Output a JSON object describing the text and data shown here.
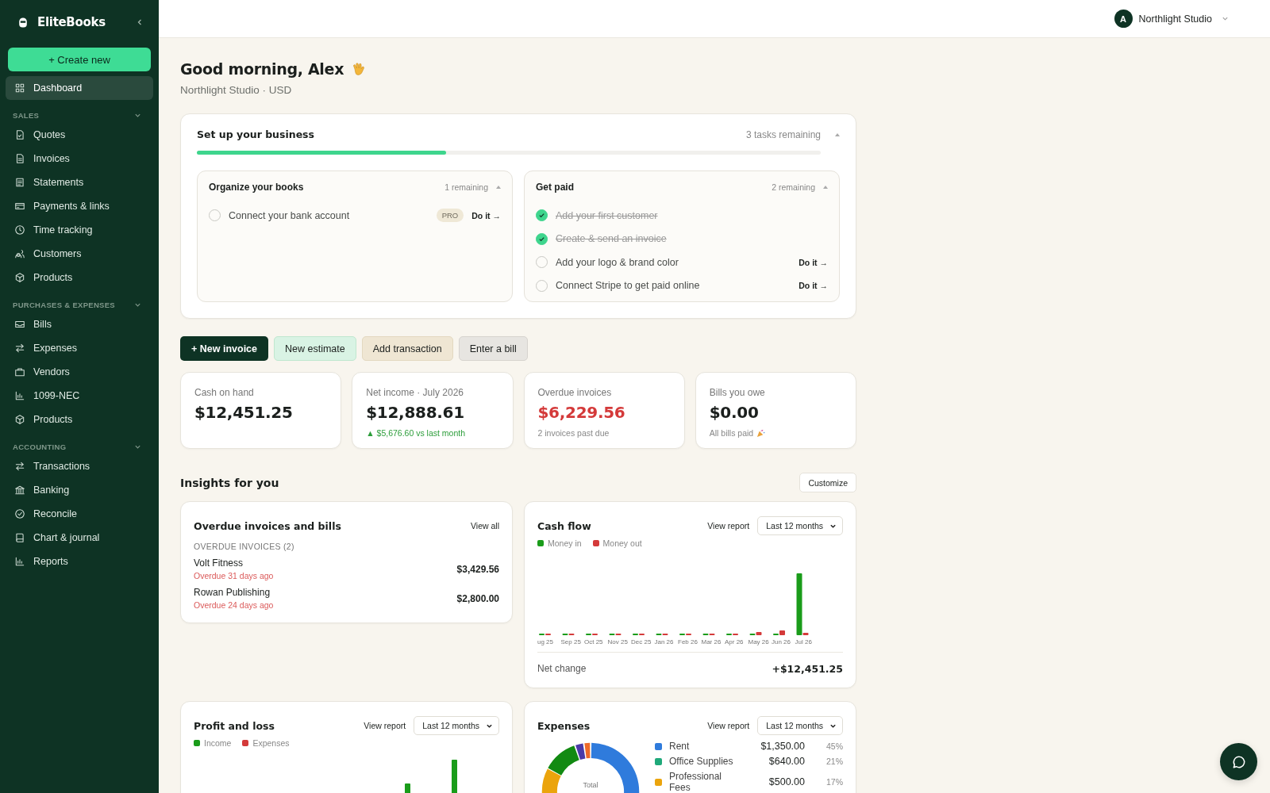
{
  "app": {
    "name": "EliteBooks"
  },
  "sidebar": {
    "create_button": "+ Create new",
    "top_items": [
      {
        "label": "Dashboard",
        "selected": true
      }
    ],
    "sections": [
      {
        "title": "SALES",
        "expanded": true,
        "items": [
          {
            "label": "Quotes",
            "selected": false
          },
          {
            "label": "Invoices",
            "selected": false
          },
          {
            "label": "Statements",
            "selected": false
          },
          {
            "label": "Payments & links",
            "selected": false
          },
          {
            "label": "Time tracking",
            "selected": false
          },
          {
            "label": "Customers",
            "selected": false
          },
          {
            "label": "Products",
            "selected": false
          }
        ]
      },
      {
        "title": "PURCHASES & EXPENSES",
        "expanded": true,
        "items": [
          {
            "label": "Bills",
            "selected": false
          },
          {
            "label": "Expenses",
            "selected": false
          },
          {
            "label": "Vendors",
            "selected": false
          },
          {
            "label": "1099-NEC",
            "selected": false
          },
          {
            "label": "Products",
            "selected": false
          }
        ]
      },
      {
        "title": "ACCOUNTING",
        "expanded": true,
        "items": [
          {
            "label": "Transactions",
            "selected": false
          },
          {
            "label": "Banking",
            "selected": false
          },
          {
            "label": "Reconcile",
            "selected": false
          },
          {
            "label": "Chart & journal",
            "selected": false
          },
          {
            "label": "Reports",
            "selected": false
          }
        ]
      }
    ]
  },
  "topbar": {
    "avatar": "A",
    "account": "Northlight Studio"
  },
  "greeting": {
    "title": "Good morning, Alex",
    "subtitle": "Northlight Studio · USD"
  },
  "setup": {
    "title": "Set up your business",
    "remaining": "3 tasks remaining",
    "level": 0.4,
    "expanded": true,
    "groups": [
      {
        "title": "Organize your books",
        "remaining": "1 remaining",
        "expanded": true,
        "tasks": [
          {
            "label": "Connect your bank account",
            "checked": false,
            "badge": "PRO",
            "action": "Do it →"
          }
        ]
      },
      {
        "title": "Get paid",
        "remaining": "2 remaining",
        "expanded": true,
        "tasks": [
          {
            "label": "Add your first customer",
            "checked": true
          },
          {
            "label": "Create & send an invoice",
            "checked": true
          },
          {
            "label": "Add your logo & brand color",
            "checked": false,
            "action": "Do it →"
          },
          {
            "label": "Connect Stripe to get paid online",
            "checked": false,
            "action": "Do it →"
          }
        ]
      }
    ]
  },
  "quick_actions": [
    {
      "label": "+ New invoice",
      "kind": "primary"
    },
    {
      "label": "New estimate",
      "kind": "mint"
    },
    {
      "label": "Add transaction",
      "kind": "sand"
    },
    {
      "label": "Enter a bill",
      "kind": "grey"
    }
  ],
  "stats": [
    {
      "label": "Cash on hand",
      "value": "$12,451.25",
      "warning": false
    },
    {
      "label": "Net income · July 2026",
      "value": "$12,888.61",
      "warning": false,
      "note": "▲ $5,676.60 vs last month",
      "trend_up": true
    },
    {
      "label": "Overdue invoices",
      "value": "$6,229.56",
      "warning": true,
      "note": "2 invoices past due",
      "trend_up": false
    },
    {
      "label": "Bills you owe",
      "value": "$0.00",
      "warning": false,
      "note": "All bills paid",
      "trend_up": false
    }
  ],
  "insights": {
    "title": "Insights for you",
    "customize_button": "Customize",
    "overdue": {
      "title": "Overdue invoices and bills",
      "link": "View all",
      "section": "OVERDUE INVOICES (2)",
      "rows": [
        {
          "name": "Volt Fitness",
          "status": "Overdue 31 days ago",
          "amount": "$3,429.56"
        },
        {
          "name": "Rowan Publishing",
          "status": "Overdue 24 days ago",
          "amount": "$2,800.00"
        }
      ]
    },
    "cash_flow": {
      "title": "Cash flow",
      "link": "View report",
      "period": "Last 12 months",
      "legend": [
        {
          "label": "Money in",
          "color": "#1a9c1a"
        },
        {
          "label": "Money out",
          "color": "#d43a3a"
        }
      ],
      "months": [
        "ug 25",
        "Sep 25",
        "Oct 25",
        "Nov 25",
        "Dec 25",
        "Jan 26",
        "Feb 26",
        "Mar 26",
        "Apr 26",
        "May 26",
        "Jun 26",
        "Jul 26"
      ],
      "net_label": "Net change",
      "net_value": "+$12,451.25"
    },
    "profit_loss": {
      "title": "Profit and loss",
      "link": "View report",
      "period": "Last 12 months",
      "legend": [
        {
          "label": "Income",
          "color": "#1a9c1a"
        },
        {
          "label": "Expenses",
          "color": "#d43a3a"
        }
      ]
    },
    "expenses": {
      "title": "Expenses",
      "link": "View report",
      "period": "Last 12 months",
      "center_label": "Total",
      "legend": [
        {
          "label": "Rent",
          "amount": "$1,350.00",
          "share": "45%",
          "color": "#2f7bdc"
        },
        {
          "label": "Office Supplies",
          "amount": "$640.00",
          "share": "21%",
          "color": "#1fa97a"
        },
        {
          "label": "Professional Fees",
          "amount": "$500.00",
          "share": "17%",
          "color": "#eba40c"
        }
      ]
    }
  }
}
